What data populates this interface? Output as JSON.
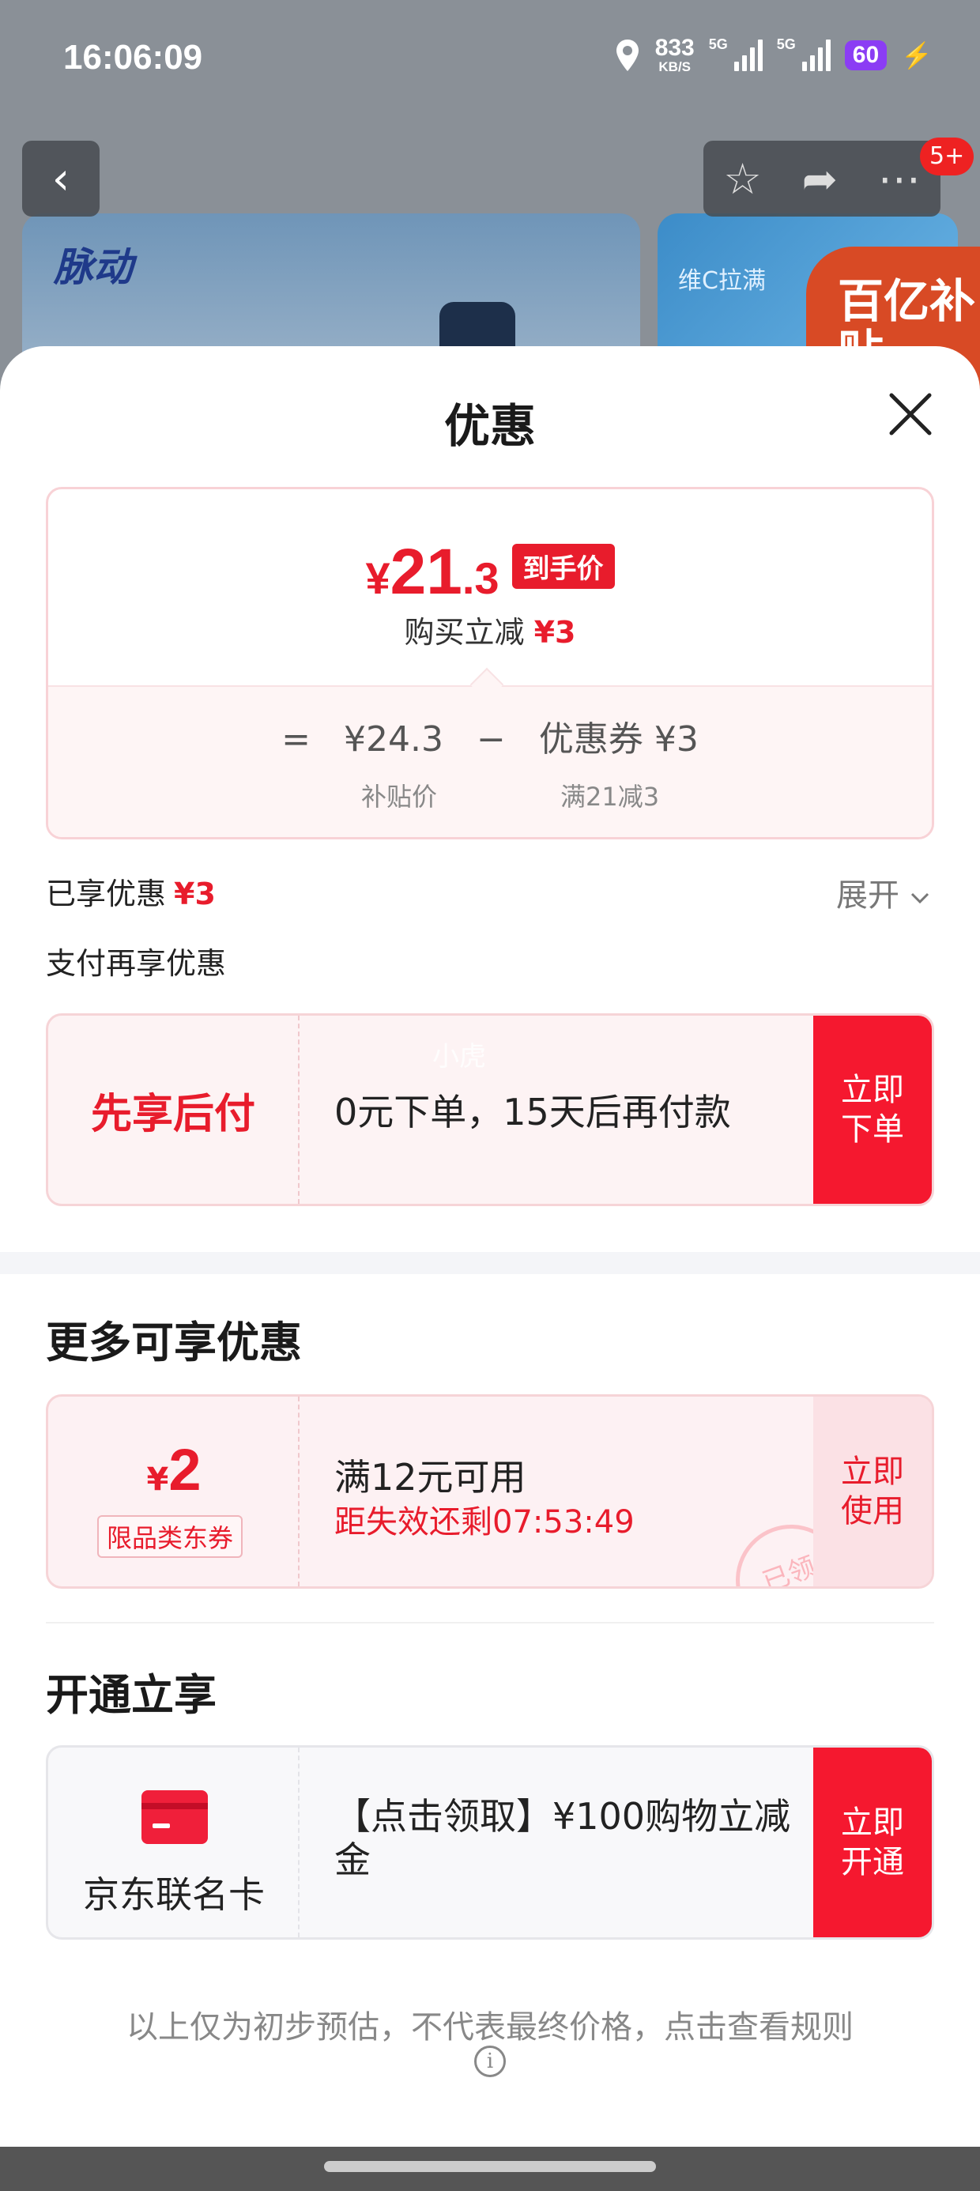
{
  "status_bar": {
    "time": "16:06:09",
    "speed": "833",
    "speed_unit": "KB/S",
    "net1": "5G",
    "net2": "5G",
    "battery": "60"
  },
  "background": {
    "badge": "5+",
    "brand_logo": "脉动",
    "banner_text": "维C拉满",
    "ribbon_text": "百亿补贴"
  },
  "sheet": {
    "title": "优惠",
    "price": {
      "yen": "¥",
      "int": "21",
      "dec": ".3",
      "tag": "到手价",
      "reduce_label": "购买立减",
      "reduce_value": "¥3",
      "eq": "=",
      "base_price": "¥24.3",
      "minus": "−",
      "coupon_part": "优惠券 ¥3",
      "base_label": "补贴价",
      "coupon_label": "满21减3"
    },
    "enjoyed_label": "已享优惠",
    "enjoyed_value": "¥3",
    "expand_label": "展开",
    "paymore_label": "支付再享优惠",
    "bnpl": {
      "title": "先享后付",
      "desc": "0元下单，15天后再付款",
      "watermark": "小虎",
      "button": "立即\n下单"
    },
    "more_title": "更多可享优惠",
    "coupon": {
      "yen": "¥",
      "amount": "2",
      "type": "限品类东券",
      "condition": "满12元可用",
      "expiry": "距失效还剩07:53:49",
      "button": "立即\n使用",
      "stamp": "已领"
    },
    "open_title": "开通立享",
    "jdcard": {
      "name": "京东联名卡",
      "desc": "【点击领取】¥100购物立减金",
      "button": "立即\n开通"
    },
    "disclaimer": "以上仅为初步预估，不代表最终价格，点击查看规则"
  }
}
